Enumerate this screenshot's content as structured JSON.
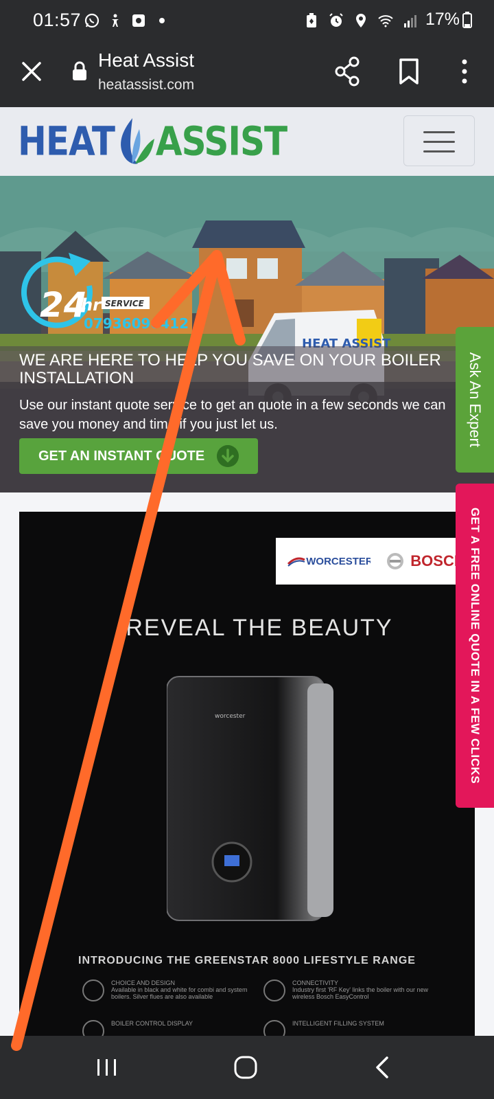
{
  "status_bar": {
    "time": "01:57",
    "battery": "17%",
    "left_icons": [
      "whatsapp-icon",
      "accessibility-icon",
      "recorder-icon",
      "dot-icon"
    ],
    "right_icons": [
      "battery-saver-icon",
      "alarm-icon",
      "location-icon",
      "wifi-icon",
      "signal-icon"
    ]
  },
  "browser": {
    "title": "Heat Assist",
    "url": "heatassist.com"
  },
  "site": {
    "logo_left": "HEAT",
    "logo_right": "ASSIST",
    "hero": {
      "badge_24": "24",
      "badge_hr": "hr",
      "badge_service": "SERVICE",
      "badge_phone": "07936090412",
      "title": "WE ARE HERE TO HELP YOU SAVE ON YOUR BOILER INSTALLATION",
      "text": "Use our instant quote service to get an quote in a few seconds we can save you money and time if you just let us.",
      "button": "GET AN INSTANT QUOTE",
      "van_logo": "HEAT ASSIST"
    },
    "promo": {
      "brand1": "WORCESTER",
      "brand2": "BOSCH",
      "headline": "REVEAL THE BEAUTY",
      "boiler_brand": "worcester",
      "introducing": "INTRODUCING THE GREENSTAR 8000 LIFESTYLE RANGE",
      "features": [
        {
          "title": "CHOICE AND DESIGN",
          "desc": "Available in black and white for combi and system boilers. Silver flues are also available"
        },
        {
          "title": "CONNECTIVITY",
          "desc": "Industry first 'RF Key' links the boiler with our new wireless Bosch EasyControl"
        },
        {
          "title": "BOILER CONTROL DISPLAY",
          "desc": ""
        },
        {
          "title": "INTELLIGENT FILLING SYSTEM",
          "desc": ""
        }
      ]
    },
    "side_tabs": {
      "ask_expert": "Ask An Expert",
      "free_quote": "GET A FREE ONLINE QUOTE IN A FEW CLICKS"
    }
  },
  "colors": {
    "accent_green": "#58a33d",
    "accent_pink": "#e3175a",
    "annotation_orange": "#ff6a2a",
    "logo_blue": "#2e5cae",
    "logo_green": "#38a04a"
  }
}
